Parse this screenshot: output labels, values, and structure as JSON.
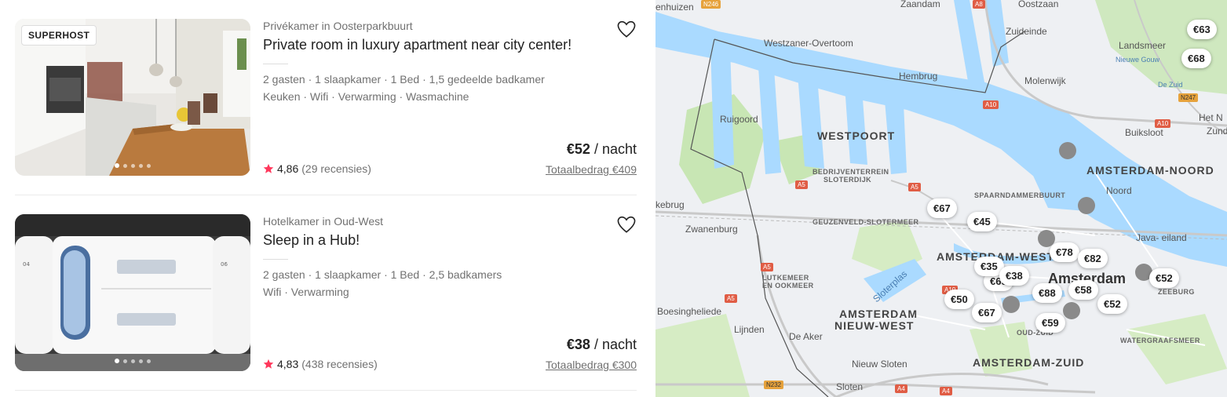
{
  "listings": [
    {
      "badge": "SUPERHOST",
      "subtitle": "Privékamer in Oosterparkbuurt",
      "title": "Private room in luxury apartment near city center!",
      "details": "2 gasten · 1 slaapkamer · 1 Bed · 1,5 gedeelde badkamer",
      "amenities": "Keuken · Wifi · Verwarming · Wasmachine",
      "rating": "4,86",
      "reviews": "(29 recensies)",
      "price": "€52",
      "price_unit": " / nacht",
      "total": "Totaalbedrag €409",
      "photo_count": 5,
      "active_photo": 0
    },
    {
      "badge": "",
      "subtitle": "Hotelkamer in Oud-West",
      "title": "Sleep in a Hub!",
      "details": "2 gasten · 1 slaapkamer · 1 Bed · 2,5 badkamers",
      "amenities": "Wifi · Verwarming",
      "rating": "4,83",
      "reviews": "(438 recensies)",
      "price": "€38",
      "price_unit": " / nacht",
      "total": "Totaalbedrag €300",
      "photo_count": 5,
      "active_photo": 0
    }
  ],
  "colors": {
    "star": "#ff385c",
    "text_primary": "#222222",
    "text_secondary": "#717171",
    "map_water": "#aadaff",
    "map_park": "#c8e6b4"
  },
  "map": {
    "labels": {
      "zaandam": "Zaandam",
      "oostzaan": "Oostzaan",
      "westzaner": "Westzaner-Overtoom",
      "zuideinde": "Zuideinde",
      "landsmeer": "Landsmeer",
      "nieuwe_gouw": "Nieuwe Gouw",
      "hembrug": "Hembrug",
      "molenwijk": "Molenwijk",
      "de_zuid": "De Zuid",
      "het_n": "Het N",
      "zunder": "Zunde",
      "ruigoord": "Ruigoord",
      "westpoort": "WESTPOORT",
      "buiksloot": "Buiksloot",
      "amsterdam_noord": "AMSTERDAM-NOORD",
      "bedrijven": "BEDRIJVENTERREIN",
      "sloterdijk": "SLOTERDIJK",
      "spaarndammerbuurt": "SPAARNDAMMERBUURT",
      "noord": "Noord",
      "kebrug": "kebrug",
      "zwanenburg": "Zwanenburg",
      "geuzenveld": "GEUZENVELD-SLOTERMEER",
      "java": "Java- eiland",
      "amsterdam_west": "AMSTERDAM-WEST",
      "amsterdam": "Amsterdam",
      "lutkemeer": "LUTKEMEER",
      "en_ookmeer": "EN OOKMEER",
      "sloterplas": "Sloterplas",
      "zeeburg": "ZEEBURG",
      "boesingheliede": "Boesingheliede",
      "amsterdam_nieuw_west_1": "AMSTERDAM",
      "amsterdam_nieuw_west_2": "NIEUW-WEST",
      "lijnden": "Lijnden",
      "de_aker": "De Aker",
      "oud_zuid": "OUD-ZUID",
      "watergraafsmeer": "WATERGRAAFSMEER",
      "nieuw_sloten": "Nieuw Sloten",
      "amsterdam_zuid": "AMSTERDAM-ZUID",
      "sloten": "Sloten",
      "huizen": "enhuizen"
    },
    "roads": {
      "a8": "A8",
      "a10_1": "A10",
      "a10_2": "A10",
      "a5_1": "A5",
      "a5_2": "A5",
      "a5_3": "A5",
      "a5_4": "A5",
      "a5_5": "A5",
      "n247": "N247",
      "n246": "N246",
      "n232": "N232",
      "a4_1": "A4",
      "a4_2": "A4",
      "a10_3": "A10"
    },
    "pins": {
      "p63": "€63",
      "p68": "€68",
      "p67a": "€67",
      "p45": "€45",
      "p78": "€78",
      "p82": "€82",
      "p35": "€35",
      "p38": "€38",
      "p52a": "€52",
      "p65": "€65",
      "p88": "€88",
      "p58": "€58",
      "p50": "€50",
      "p52b": "€52",
      "p67b": "€67",
      "p59": "€59"
    },
    "poi_icons": [
      "fork-knife-icon",
      "fork-knife-icon",
      "fork-knife-icon",
      "cake-icon",
      "camera-icon",
      "museum-icon"
    ]
  }
}
